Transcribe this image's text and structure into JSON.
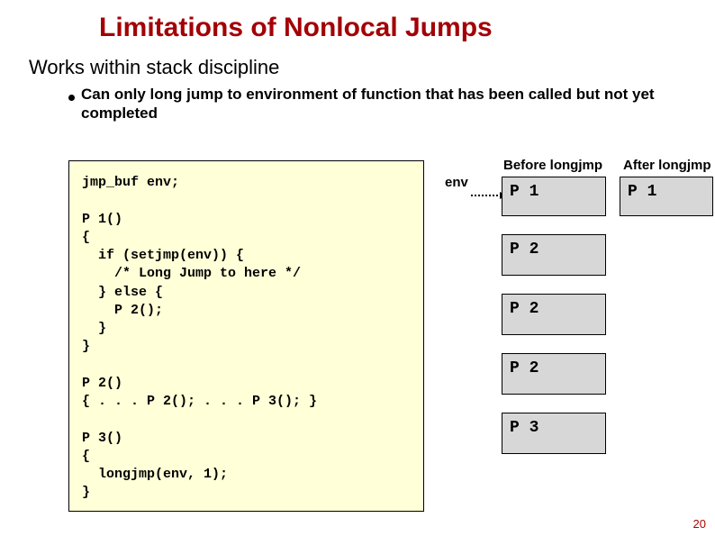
{
  "title": "Limitations of Nonlocal Jumps",
  "subtitle": "Works within stack discipline",
  "bullet": "Can only long jump to environment of function that has been called but not yet completed",
  "code": "jmp_buf env;\n\nP 1()\n{\n  if (setjmp(env)) {\n    /* Long Jump to here */\n  } else {\n    P 2();\n  }\n}\n\nP 2()\n{ . . . P 2(); . . . P 3(); }\n\nP 3()\n{\n  longjmp(env, 1);\n}",
  "labels": {
    "before": "Before longjmp",
    "after": "After longjmp",
    "env": "env"
  },
  "stack": {
    "before": [
      "P 1",
      "P 2",
      "P 2",
      "P 2",
      "P 3"
    ],
    "after": [
      "P 1"
    ]
  },
  "page_number": "20"
}
